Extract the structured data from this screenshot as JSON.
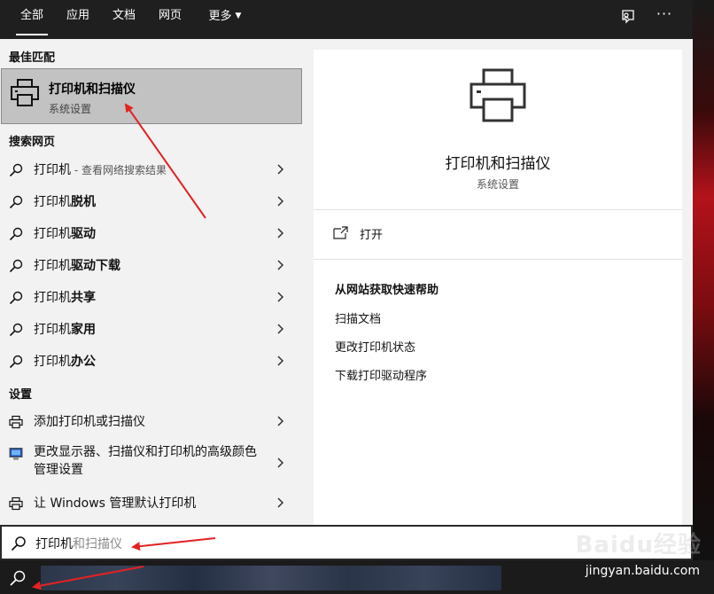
{
  "tabs": [
    {
      "label": "全部",
      "active": true
    },
    {
      "label": "应用"
    },
    {
      "label": "文档"
    },
    {
      "label": "网页"
    },
    {
      "label": "更多"
    }
  ],
  "header_icons": [
    "feedback-icon",
    "more-options-icon"
  ],
  "more_dots": "···",
  "best_match": {
    "section": "最佳匹配",
    "title": "打印机和扫描仪",
    "subtitle": "系统设置",
    "icon": "printer-icon"
  },
  "web_search": {
    "section": "搜索网页",
    "items": [
      {
        "prefix": "打印机",
        "bold": "",
        "hint": " - 查看网络搜索结果"
      },
      {
        "prefix": "打印机",
        "bold": "脱机",
        "hint": ""
      },
      {
        "prefix": "打印机",
        "bold": "驱动",
        "hint": ""
      },
      {
        "prefix": "打印机",
        "bold": "驱动下载",
        "hint": ""
      },
      {
        "prefix": "打印机",
        "bold": "共享",
        "hint": ""
      },
      {
        "prefix": "打印机",
        "bold": "家用",
        "hint": ""
      },
      {
        "prefix": "打印机",
        "bold": "办公",
        "hint": ""
      }
    ]
  },
  "settings": {
    "section": "设置",
    "items": [
      {
        "label": "添加打印机或扫描仪",
        "icon": "printer-icon"
      },
      {
        "label": "更改显示器、扫描仪和打印机的高级颜色管理设置",
        "icon": "monitor-icon"
      },
      {
        "label": "让 Windows 管理默认打印机",
        "icon": "printer-icon"
      }
    ]
  },
  "preview": {
    "title": "打印机和扫描仪",
    "subtitle": "系统设置",
    "open_label": "打开",
    "help_title": "从网站获取快速帮助",
    "help_links": [
      "扫描文档",
      "更改打印机状态",
      "下载打印驱动程序"
    ]
  },
  "search": {
    "typed": "打印机",
    "ghost": "和扫描仪"
  },
  "watermark": {
    "brand": "Baidu经验",
    "url": "jingyan.baidu.com"
  },
  "colors": {
    "topbar": "#1f1f1f",
    "panel": "#f2f2f2",
    "selected": "#c2c2c2",
    "annotation_arrow": "#e32222"
  }
}
